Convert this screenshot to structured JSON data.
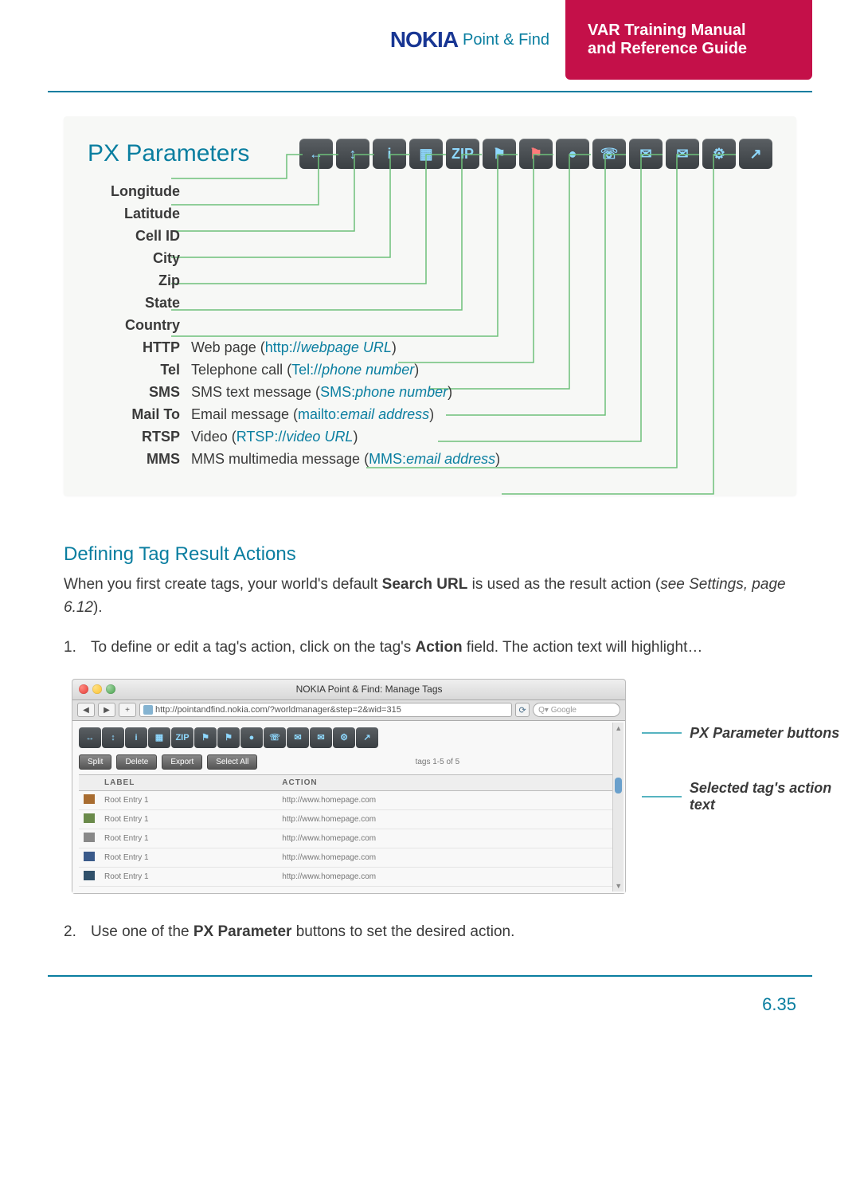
{
  "header": {
    "logo": "NOKIA",
    "logo_sub": "Point & Find",
    "title1": "VAR Training Manual",
    "title2": "and Reference Guide"
  },
  "px": {
    "title": "PX Parameters",
    "icons": [
      "↔",
      "↕",
      "i",
      "▦",
      "ZIP",
      "⚑",
      "⚑",
      "●",
      "☏",
      "✉",
      "✉",
      "⚙",
      "↗"
    ],
    "params": {
      "longitude": {
        "label": "Longitude",
        "val": ""
      },
      "latitude": {
        "label": "Latitude",
        "val": ""
      },
      "cellid": {
        "label": "Cell ID",
        "val": ""
      },
      "city": {
        "label": "City",
        "val": ""
      },
      "zip": {
        "label": "Zip",
        "val": ""
      },
      "state": {
        "label": "State",
        "val": ""
      },
      "country": {
        "label": "Country",
        "val": ""
      },
      "http": {
        "label": "HTTP",
        "pre": "Web page (",
        "link": "http://",
        "it": "webpage URL",
        "post": ")"
      },
      "tel": {
        "label": "Tel",
        "pre": "Telephone call (",
        "link": "Tel://",
        "it": "phone number",
        "post": ")"
      },
      "sms": {
        "label": "SMS",
        "pre": "SMS text message (",
        "link": "SMS:",
        "it": "phone number",
        "post": ")"
      },
      "mailto": {
        "label": "Mail To",
        "pre": "Email message (",
        "link": "mailto:",
        "it": "email address",
        "post": ")"
      },
      "rtsp": {
        "label": "RTSP",
        "pre": "Video (",
        "link": "RTSP://",
        "it": "video URL",
        "post": ")"
      },
      "mms": {
        "label": "MMS",
        "pre": "MMS multimedia message (",
        "link": "MMS:",
        "it": "email address",
        "post": ")"
      }
    }
  },
  "section": {
    "title": "Defining Tag Result Actions",
    "body_a": "When you first create tags, your world's default ",
    "body_b": "Search URL",
    "body_c": " is used as the result action (",
    "body_it": "see Settings, page 6.12",
    "body_d": ")."
  },
  "step1": {
    "num": "1.",
    "a": "To define or edit a tag's action, click on the tag's ",
    "b": "Action",
    "c": " field. The action text will highlight…"
  },
  "shot": {
    "title": "NOKIA Point & Find: Manage Tags",
    "nav_back": "◀",
    "nav_fwd": "▶",
    "nav_add": "+",
    "url": "http://pointandfind.nokia.com/?worldmanager&step=2&wid=315",
    "reload": "⟳",
    "search_placeholder": "Q▾ Google",
    "mini_icons": [
      "↔",
      "↕",
      "i",
      "▦",
      "ZIP",
      "⚑",
      "⚑",
      "●",
      "☏",
      "✉",
      "✉",
      "⚙",
      "↗"
    ],
    "btns": {
      "split": "Split",
      "delete": "Delete",
      "export": "Export",
      "select": "Select All"
    },
    "count": "tags 1-5 of 5",
    "th": {
      "label": "LABEL",
      "action": "ACTION"
    },
    "rows": [
      {
        "label": "Root Entry 1",
        "action": "http://www.homepage.com",
        "selected": true
      },
      {
        "label": "Root Entry 1",
        "action": "http://www.homepage.com"
      },
      {
        "label": "Root Entry 1",
        "action": "http://www.homepage.com"
      },
      {
        "label": "Root Entry 1",
        "action": "http://www.homepage.com"
      },
      {
        "label": "Root Entry 1",
        "action": "http://www.homepage.com"
      }
    ]
  },
  "annot": {
    "a": "PX Parameter buttons",
    "b": "Selected tag's action text"
  },
  "step2": {
    "num": "2.",
    "a": "Use one of the ",
    "b": "PX Parameter",
    "c": " buttons to set the desired action."
  },
  "pagenum": "6.35"
}
